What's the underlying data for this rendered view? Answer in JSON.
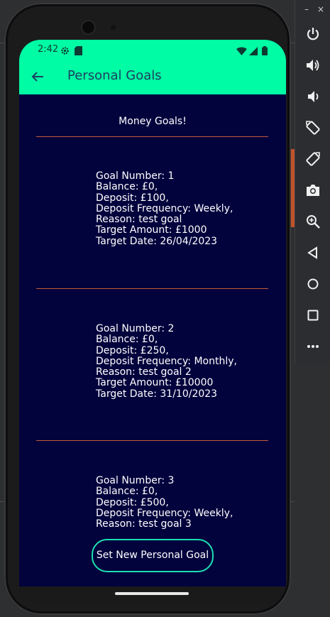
{
  "status_bar": {
    "time": "2:42"
  },
  "toolbar": {
    "title": "Personal Goals"
  },
  "content": {
    "section_title": "Money Goals!",
    "goals": [
      {
        "goal_number": "Goal Number: 1",
        "balance": "Balance: £0,",
        "deposit": "Deposit: £100,",
        "frequency": "Deposit Frequency: Weekly,",
        "reason": "Reason: test goal",
        "target_amount": "Target Amount: £1000",
        "target_date": "Target Date: 26/04/2023"
      },
      {
        "goal_number": "Goal Number: 2",
        "balance": "Balance: £0,",
        "deposit": "Deposit: £250,",
        "frequency": "Deposit Frequency: Monthly,",
        "reason": "Reason: test goal 2",
        "target_amount": "Target Amount: £10000",
        "target_date": "Target Date: 31/10/2023"
      },
      {
        "goal_number": "Goal Number: 3",
        "balance": "Balance: £0,",
        "deposit": "Deposit: £500,",
        "frequency": "Deposit Frequency: Weekly,",
        "reason": "Reason: test goal 3"
      }
    ],
    "new_goal_button": "Set New Personal Goal"
  },
  "emulator_panel": {
    "minimize": "–",
    "close": "×",
    "buttons": [
      "power-icon",
      "volume-up-icon",
      "volume-down-icon",
      "rotate-left-icon",
      "rotate-right-icon",
      "camera-icon",
      "zoom-icon",
      "back-icon",
      "home-icon",
      "overview-icon",
      "more-icon"
    ]
  },
  "colors": {
    "app_bar": "#00fca4",
    "background": "#02023d",
    "divider": "#c45b36",
    "button_border": "#1ce0b0",
    "title_text": "#1d3f61"
  }
}
